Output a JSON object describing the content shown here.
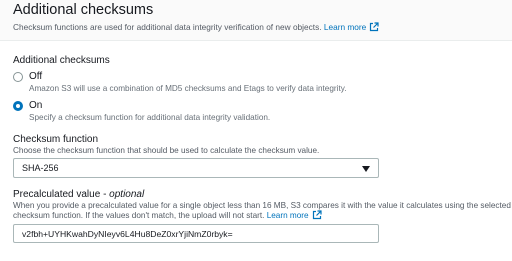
{
  "header": {
    "title": "Additional checksums",
    "description": "Checksum functions are used for additional data integrity verification of new objects.",
    "learn_more": "Learn more"
  },
  "additional_checksums": {
    "label": "Additional checksums",
    "options": [
      {
        "label": "Off",
        "description": "Amazon S3 will use a combination of MD5 checksums and Etags to verify data integrity.",
        "selected": false
      },
      {
        "label": "On",
        "description": "Specify a checksum function for additional data integrity validation.",
        "selected": true
      }
    ]
  },
  "checksum_function": {
    "label": "Checksum function",
    "description": "Choose the checksum function that should be used to calculate the checksum value.",
    "selected": "SHA-256"
  },
  "precalculated": {
    "label": "Precalculated value",
    "optional": "optional",
    "description_line1": "When you provide a precalculated value for a single object less than 16 MB, S3 compares it with the value it calculates using the selected",
    "description_line2": "checksum function. If the values don't match, the upload will not start.",
    "learn_more": "Learn more",
    "value": "v2fbh+UYHKwahDyNIeyv6L4Hu8DeZ0xrYjiNmZ0rbyk="
  },
  "colors": {
    "link": "#0073bb",
    "radio_selected": "#0073bb"
  },
  "icons": {
    "external_link": "external-link-icon",
    "select_caret": "caret-down-icon"
  }
}
